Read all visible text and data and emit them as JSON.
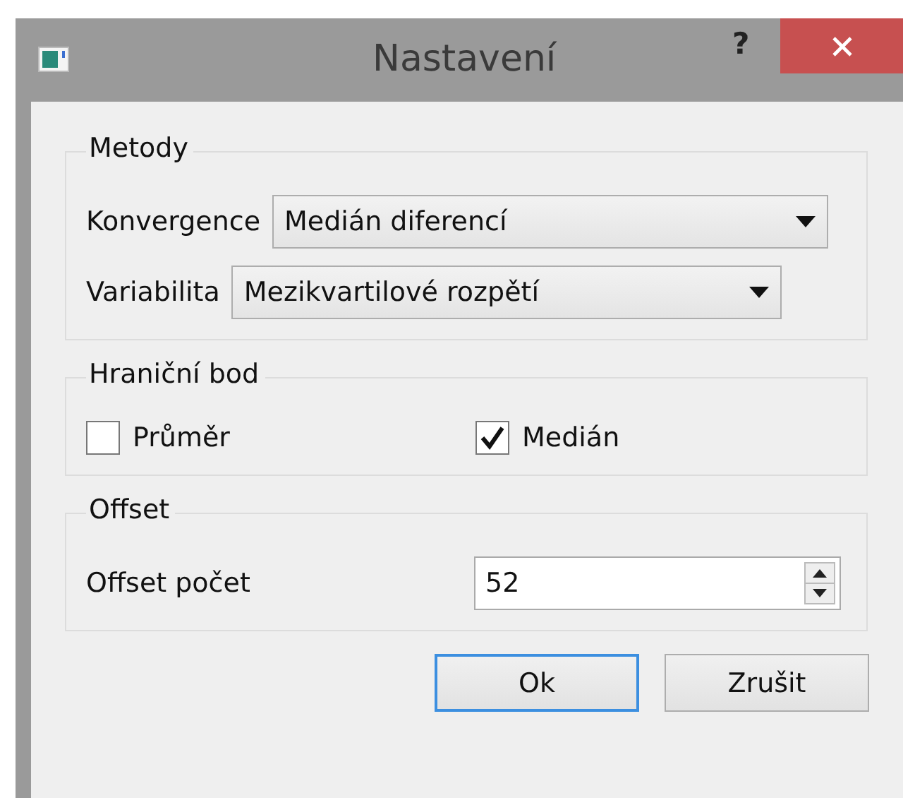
{
  "window": {
    "title": "Nastavení",
    "help": "?"
  },
  "groups": [
    {
      "title": "Metody",
      "kind": "combos",
      "rows": [
        {
          "label": "Konvergence",
          "value": "Medián diferencí"
        },
        {
          "label": "Variabilita",
          "value": "Mezikvartilové rozpětí"
        }
      ]
    },
    {
      "title": "Hraniční bod",
      "kind": "checks",
      "items": [
        {
          "label": "Průměr",
          "checked": false
        },
        {
          "label": "Medián",
          "checked": true
        }
      ]
    },
    {
      "title": "Offset",
      "kind": "spin",
      "label": "Offset počet",
      "value": "52"
    }
  ],
  "buttons": [
    {
      "label": "Ok",
      "focused": true
    },
    {
      "label": "Zrušit",
      "focused": false
    }
  ]
}
